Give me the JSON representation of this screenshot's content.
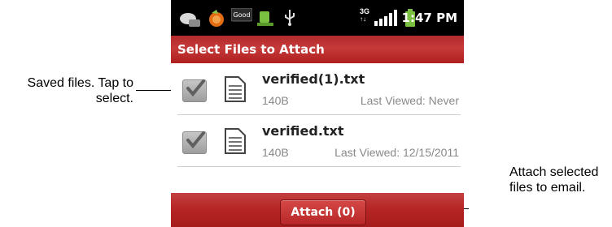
{
  "callouts": {
    "left": "Saved files. Tap to select.",
    "right": "Attach selected files to email."
  },
  "statusbar": {
    "time": "1:47 PM",
    "good_label": "Good",
    "signal_label": "3G",
    "icons": [
      "chat-bubble-icon",
      "notification-orange-icon",
      "good-badge-icon",
      "android-data-icon",
      "usb-icon",
      "3g-icon",
      "signal-bars-icon",
      "battery-icon"
    ]
  },
  "title": "Select Files to Attach",
  "files": [
    {
      "name": "verified(1).txt",
      "size": "140B",
      "last_viewed": "Last Viewed: Never",
      "checked": true
    },
    {
      "name": "verified.txt",
      "size": "140B",
      "last_viewed": "Last Viewed: 12/15/2011",
      "checked": true
    }
  ],
  "attach_button": "Attach (0)",
  "colors": {
    "titlebar": "#b82a2a",
    "statusbar": "#000000"
  }
}
